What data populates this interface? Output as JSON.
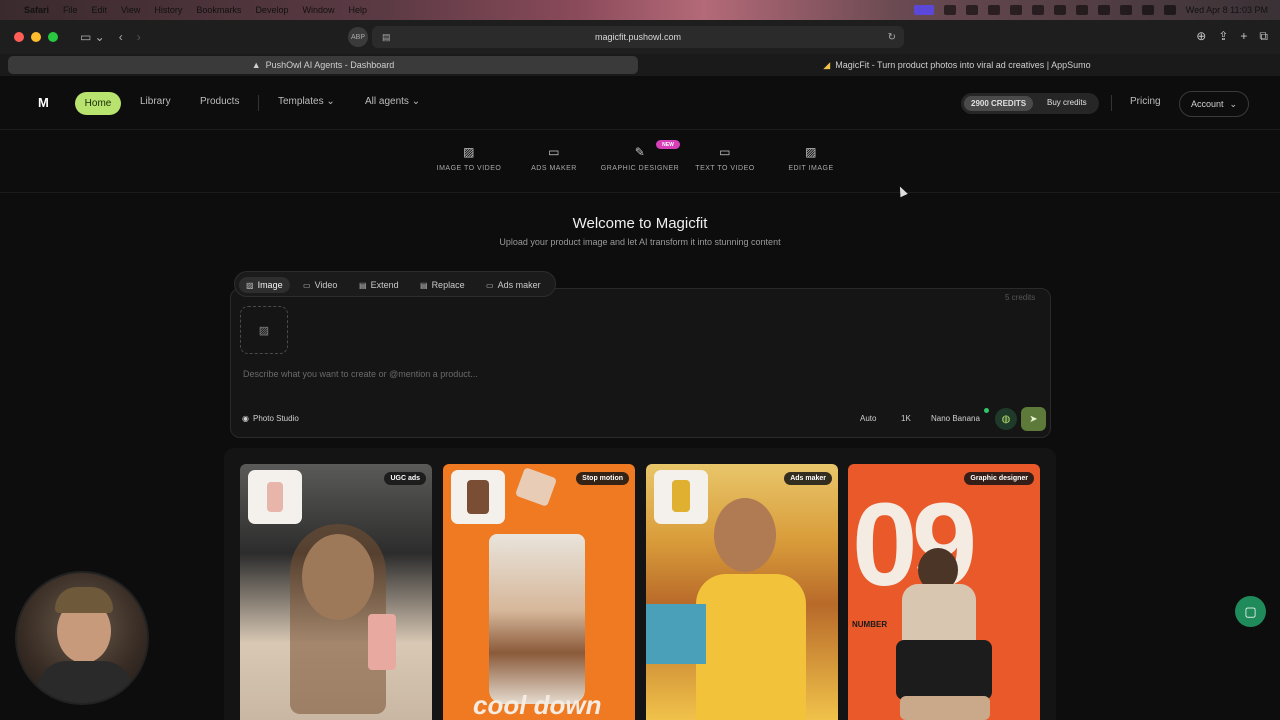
{
  "menubar": {
    "app": "Safari",
    "items": [
      "File",
      "Edit",
      "View",
      "History",
      "Bookmarks",
      "Develop",
      "Window",
      "Help"
    ],
    "clock": "Wed Apr 8  11:03 PM"
  },
  "browser": {
    "url": "magicfit.pushowl.com",
    "tabs": [
      {
        "title": "PushOwl AI Agents - Dashboard",
        "active": true
      },
      {
        "title": "MagicFit - Turn product photos into viral ad creatives | AppSumo",
        "active": false
      }
    ]
  },
  "nav": {
    "home": "Home",
    "library": "Library",
    "products": "Products",
    "templates": "Templates",
    "all_agents": "All agents",
    "credits": "2900 CREDITS",
    "buy_credits": "Buy credits",
    "pricing": "Pricing",
    "account": "Account"
  },
  "tools": [
    {
      "label": "IMAGE TO VIDEO",
      "icon": "image-icon"
    },
    {
      "label": "ADS MAKER",
      "icon": "monitor-icon"
    },
    {
      "label": "GRAPHIC DESIGNER",
      "icon": "brush-icon",
      "badge": "NEW"
    },
    {
      "label": "TEXT TO VIDEO",
      "icon": "video-camera-icon"
    },
    {
      "label": "EDIT IMAGE",
      "icon": "edit-image-icon"
    }
  ],
  "hero": {
    "title": "Welcome to Magicfit",
    "subtitle": "Upload your product image and let AI transform it into stunning content"
  },
  "composer": {
    "modes": [
      "Image",
      "Video",
      "Extend",
      "Replace",
      "Ads maker"
    ],
    "active_mode": "Image",
    "credit_cost": "5 credits",
    "placeholder": "Describe what you want to create or @mention a product...",
    "photo_studio": "Photo Studio",
    "aspect": "Auto",
    "resolution": "1K",
    "model": "Nano Banana"
  },
  "gallery": [
    {
      "tag": "UGC ads"
    },
    {
      "tag": "Stop motion",
      "caption": "cool down"
    },
    {
      "tag": "Ads maker"
    },
    {
      "tag": "Graphic designer",
      "number": "09",
      "word": "NUMBER"
    }
  ],
  "colors": {
    "accent": "#b7e36e",
    "background": "#0d0d0d",
    "new_badge": "#d63fb8"
  }
}
